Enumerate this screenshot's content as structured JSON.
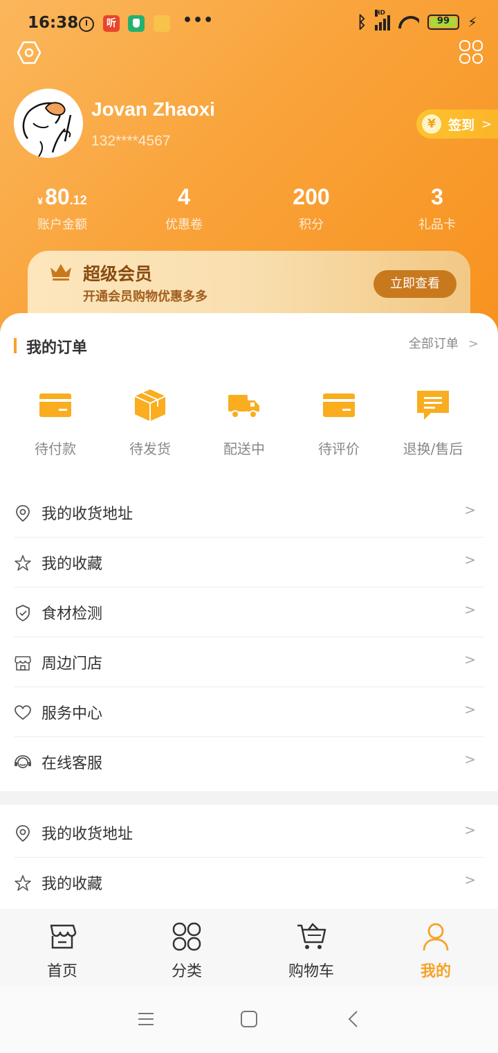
{
  "status_bar": {
    "time": "16:38",
    "app1_text": "听",
    "dots": "•••",
    "hd": "HD",
    "battery": "99",
    "battery_fraction": 0.99,
    "battery_color": "#a6d93b"
  },
  "profile": {
    "username": "Jovan Zhaoxi",
    "phone": "132****4567",
    "signin_coin": "¥",
    "signin_label": "签到",
    "signin_arrow": ">"
  },
  "stats": [
    {
      "currency": "¥",
      "value": "80",
      "decimal": ".12",
      "label": "账户金额"
    },
    {
      "currency": "",
      "value": "4",
      "decimal": "",
      "label": "优惠卷"
    },
    {
      "currency": "",
      "value": "200",
      "decimal": "",
      "label": "积分"
    },
    {
      "currency": "",
      "value": "3",
      "decimal": "",
      "label": "礼品卡"
    }
  ],
  "vip": {
    "title": "超级会员",
    "subtitle": "开通会员购物优惠多多",
    "button": "立即查看"
  },
  "orders": {
    "title": "我的订单",
    "all_label": "全部订单",
    "arrow": ">",
    "items": [
      {
        "label": "待付款",
        "icon": "card-icon"
      },
      {
        "label": "待发货",
        "icon": "box-icon"
      },
      {
        "label": "配送中",
        "icon": "truck-icon"
      },
      {
        "label": "待评价",
        "icon": "card-icon"
      },
      {
        "label": "退换/售后",
        "icon": "message-icon"
      }
    ]
  },
  "menu": [
    {
      "label": "我的收货地址",
      "icon": "location-icon"
    },
    {
      "label": "我的收藏",
      "icon": "star-icon"
    },
    {
      "label": "食材检测",
      "icon": "shield-check-icon"
    },
    {
      "label": "周边门店",
      "icon": "store-icon"
    },
    {
      "label": "服务中心",
      "icon": "heart-icon"
    },
    {
      "label": "在线客服",
      "icon": "headset-icon"
    }
  ],
  "menu2": [
    {
      "label": "我的收货地址",
      "icon": "location-icon"
    },
    {
      "label": "我的收藏",
      "icon": "star-icon"
    }
  ],
  "menu_arrow": ">",
  "tabs": [
    {
      "label": "首页",
      "icon": "home-store-icon",
      "active": false
    },
    {
      "label": "分类",
      "icon": "category-grid-icon",
      "active": false
    },
    {
      "label": "购物车",
      "icon": "cart-icon",
      "active": false
    },
    {
      "label": "我的",
      "icon": "user-icon",
      "active": true
    }
  ],
  "colors": {
    "accent": "#f7a227",
    "header_gradient_start": "#fbb75c",
    "header_gradient_end": "#f8911d",
    "vip_button": "#c8791d"
  }
}
